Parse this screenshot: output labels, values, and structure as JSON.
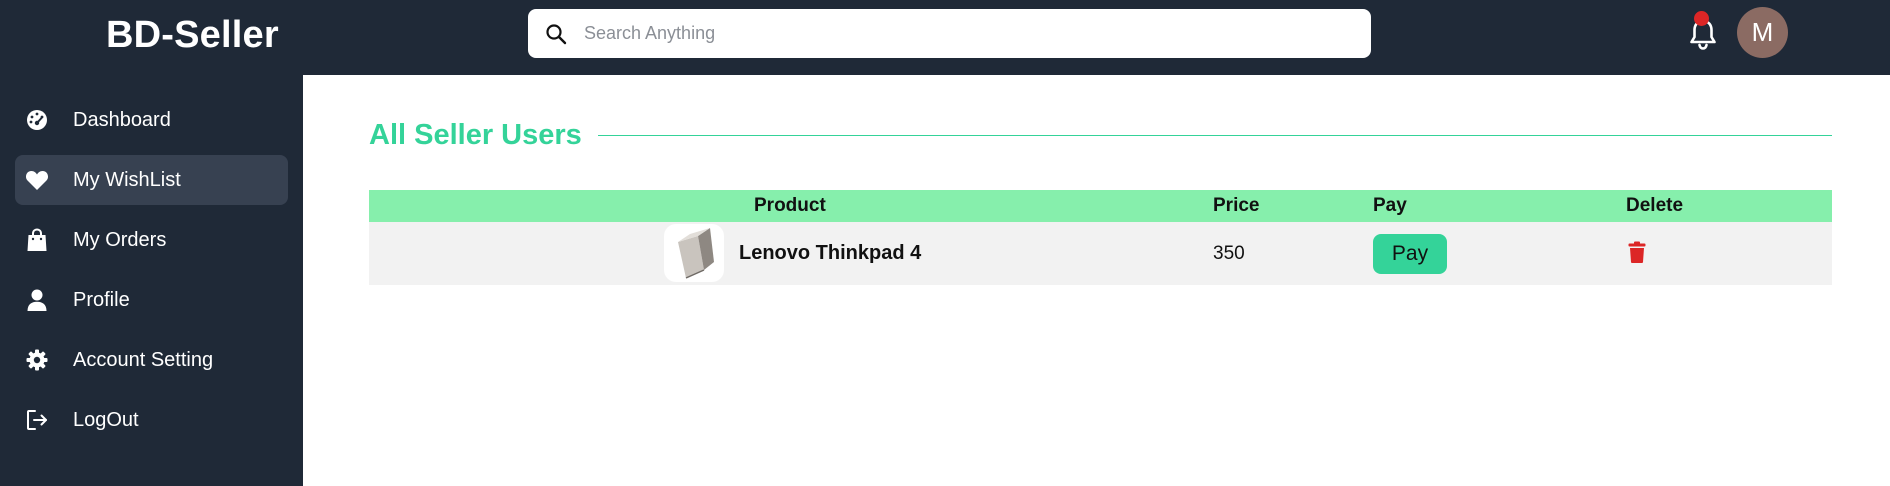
{
  "header": {
    "brand": "BD-Seller",
    "search_placeholder": "Search Anything",
    "avatar_initial": "M"
  },
  "sidebar": {
    "items": [
      {
        "label": "Dashboard",
        "icon": "gauge-icon",
        "active": false
      },
      {
        "label": "My WishList",
        "icon": "heart-icon",
        "active": true
      },
      {
        "label": "My Orders",
        "icon": "shopping-bag-icon",
        "active": false
      },
      {
        "label": "Profile",
        "icon": "user-icon",
        "active": false
      },
      {
        "label": "Account Setting",
        "icon": "gear-icon",
        "active": false
      },
      {
        "label": "LogOut",
        "icon": "logout-icon",
        "active": false
      }
    ]
  },
  "main": {
    "title": "All Seller Users",
    "table": {
      "headers": {
        "product": "Product",
        "price": "Price",
        "pay": "Pay",
        "delete": "Delete"
      },
      "rows": [
        {
          "product": "Lenovo Thinkpad 4",
          "price": "350",
          "pay_label": "Pay"
        }
      ]
    }
  },
  "colors": {
    "sidebar_bg": "#1f2937",
    "accent": "#34d399",
    "table_header_bg": "#86efac",
    "delete_red": "#dc2626",
    "notification_dot": "#dc2626"
  }
}
